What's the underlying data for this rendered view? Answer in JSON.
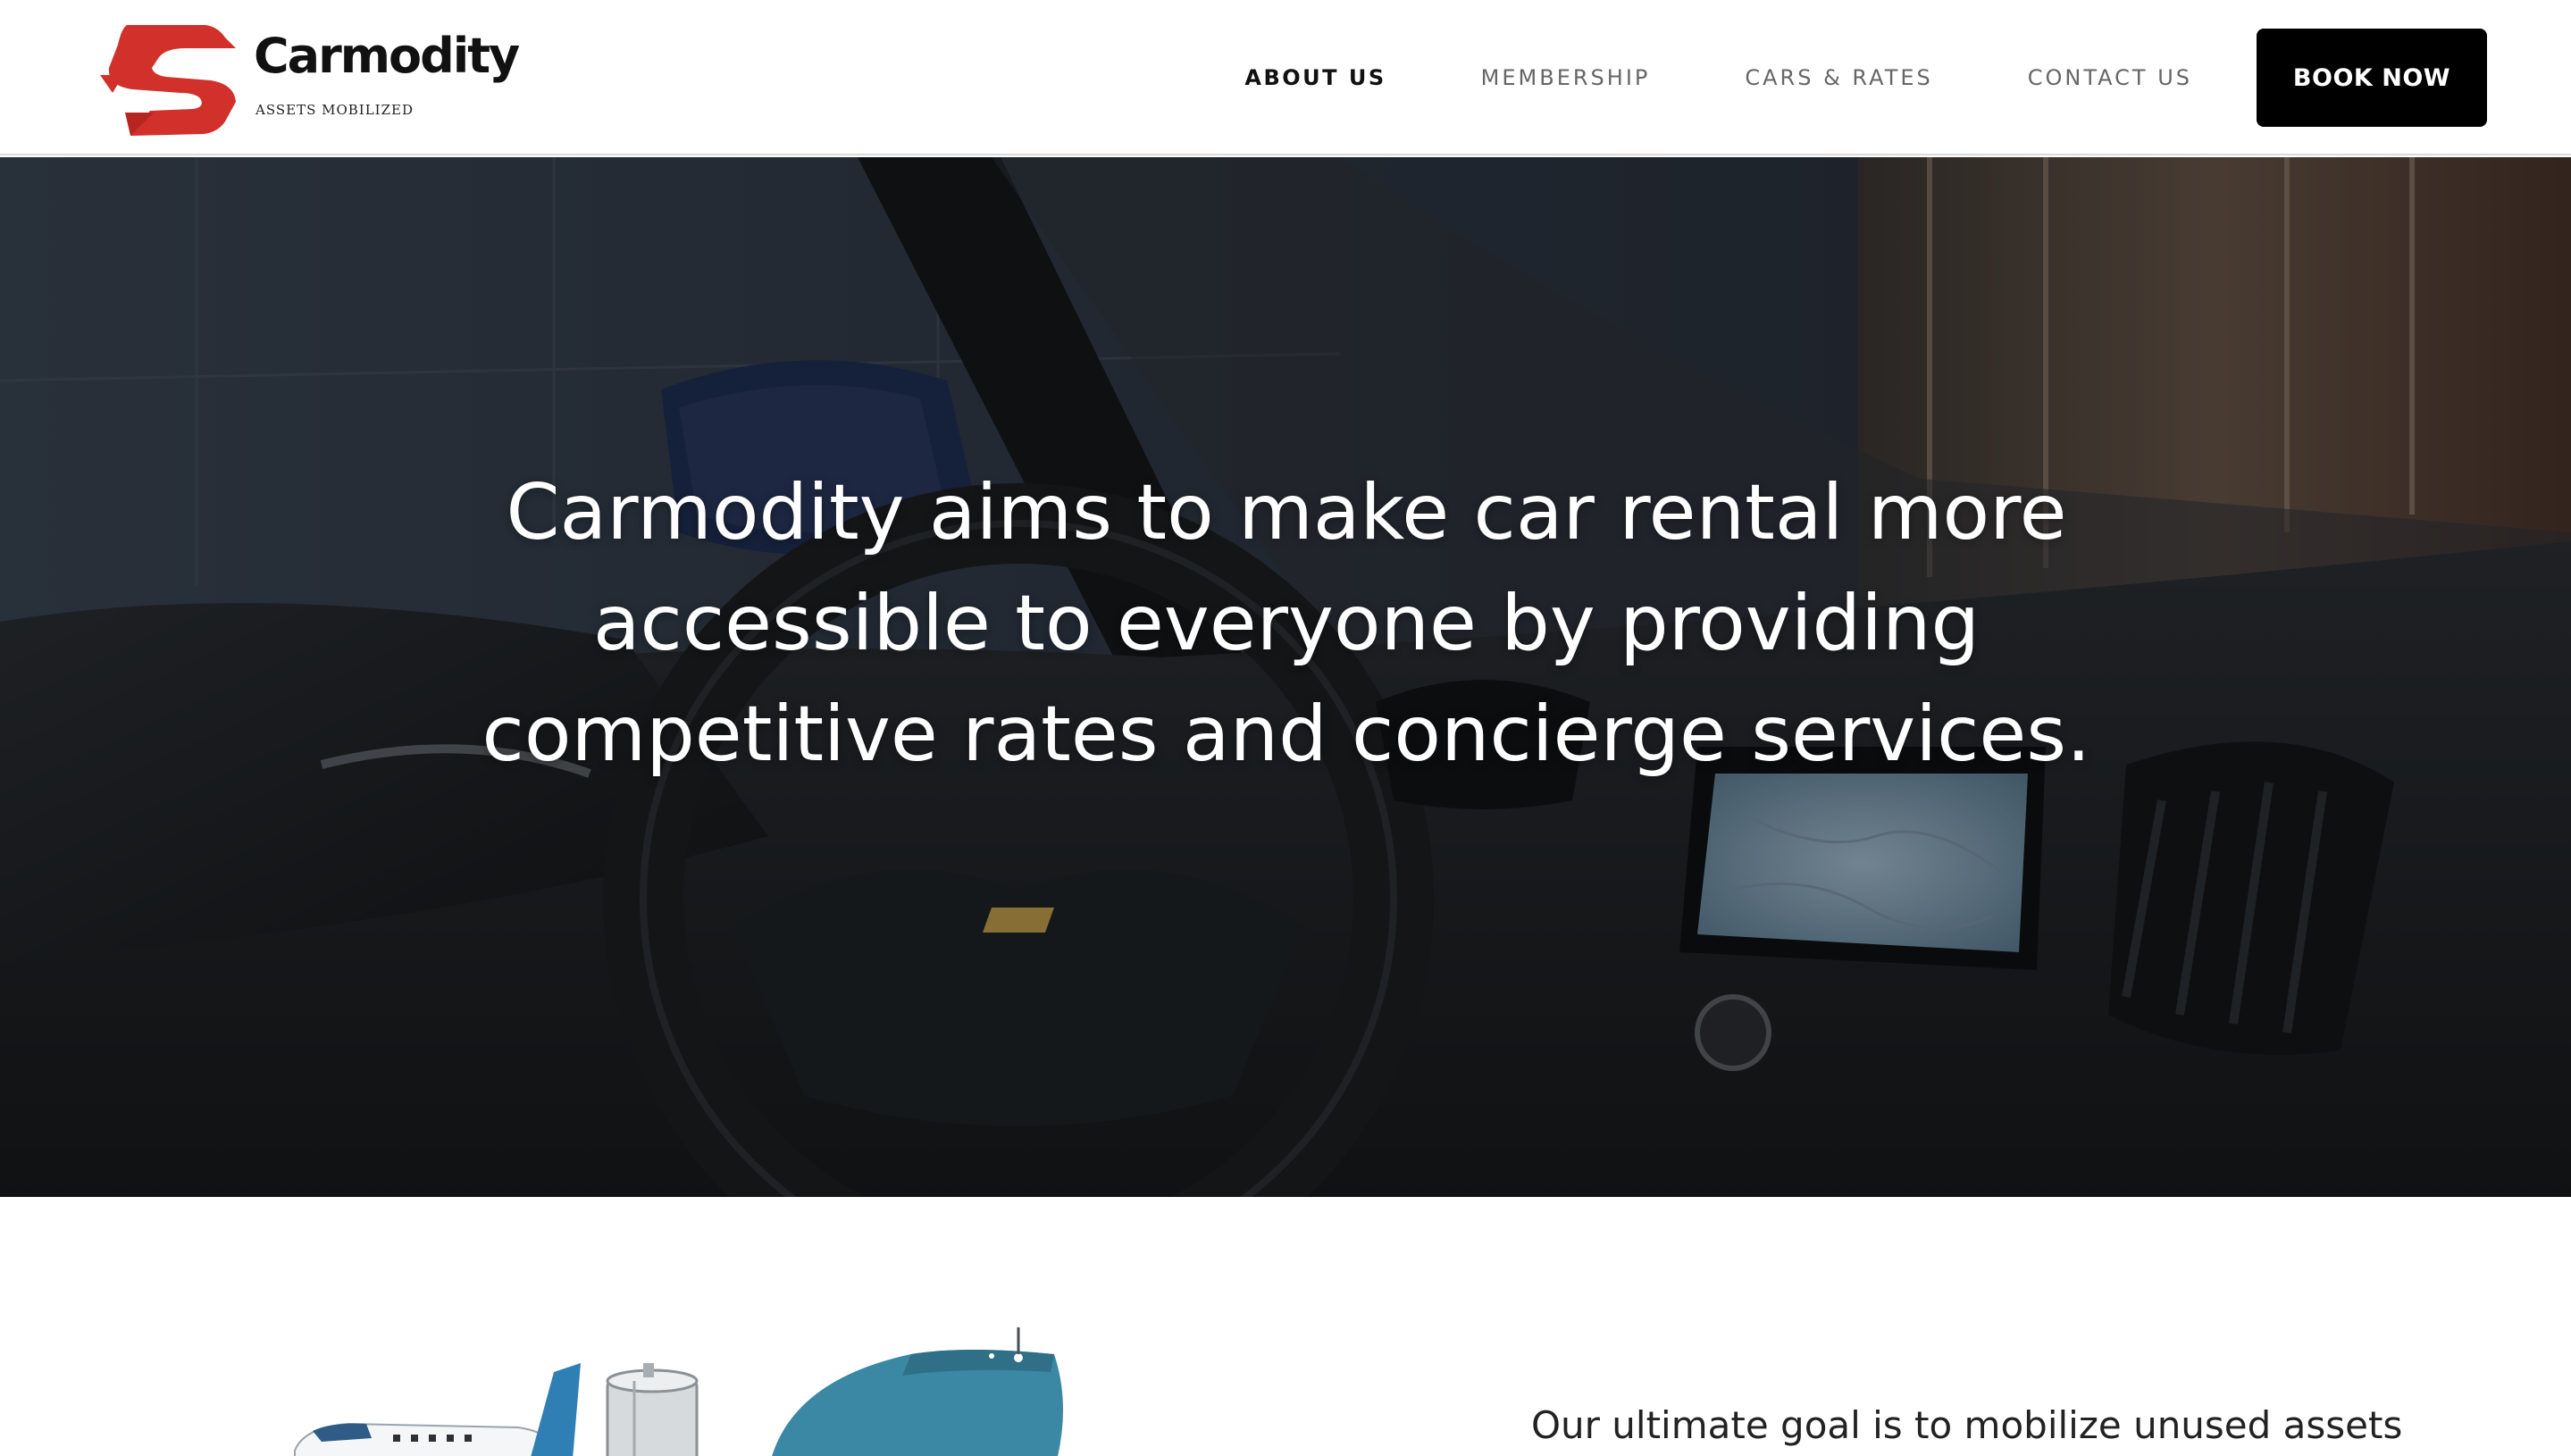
{
  "header": {
    "logo": {
      "wordmark": "Carmodity",
      "tagline": "ASSETS MOBILIZED",
      "brand_color": "#d2302a"
    },
    "nav": [
      {
        "label": "ABOUT US",
        "active": true
      },
      {
        "label": "MEMBERSHIP",
        "active": false
      },
      {
        "label": "CARS & RATES",
        "active": false
      },
      {
        "label": "CONTACT US",
        "active": false
      }
    ],
    "cta_label": "BOOK NOW"
  },
  "hero": {
    "heading": "Carmodity aims to make car rental more accessible to everyone by providing competitive rates and concierge services.",
    "image": "car-interior-dashboard"
  },
  "about": {
    "goal_text": "Our ultimate goal is to mobilize unused assets",
    "illustration": "airplane-tanker-ship-illustration"
  }
}
